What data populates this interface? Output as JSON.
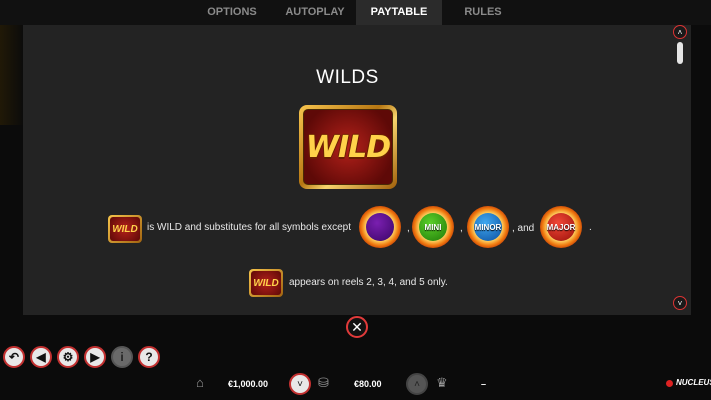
{
  "tabs": [
    "OPTIONS",
    "AUTOPLAY",
    "PAYTABLE",
    "RULES"
  ],
  "active_tab": "PAYTABLE",
  "section_title": "WILDS",
  "wild_symbol_text": "WILD",
  "line1": {
    "text": "is WILD and substitutes for all symbols except",
    "sep1": ",",
    "sep2": ",",
    "and": ", and",
    "end": ".",
    "mini_label": "MINI",
    "minor_label": "MINOR",
    "major_label": "MAJOR"
  },
  "line2": {
    "text": "appears on reels 2, 3, 4, and 5 only."
  },
  "footer": {
    "balance": "€1,000.00",
    "bet": "€80.00",
    "win": "–",
    "brand": "NUCLEUS"
  },
  "colors": {
    "accent": "#c23030",
    "panel": "#232323",
    "tab_active": "#2b2b2b"
  },
  "icons": [
    "back-arrow-icon",
    "sound-icon",
    "gear-icon",
    "play-icon",
    "info-icon",
    "help-icon",
    "bank-icon",
    "coins-icon",
    "trophy-icon",
    "close-icon"
  ]
}
